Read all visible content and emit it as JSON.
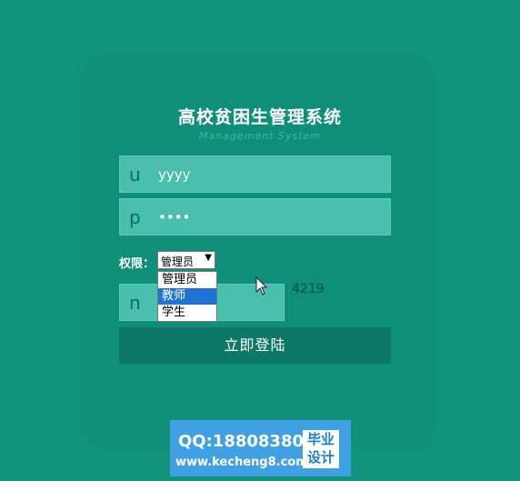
{
  "header": {
    "title": "高校贫困生管理系统",
    "subtitle": "Management System"
  },
  "form": {
    "username": {
      "icon_letter": "u",
      "value": "yyyy"
    },
    "password": {
      "icon_letter": "p",
      "value": "••••"
    },
    "role": {
      "label": "权限：",
      "selected": "管理员",
      "options": [
        "管理员",
        "教师",
        "学生"
      ],
      "highlighted": "教师"
    },
    "captcha": {
      "icon_letter": "n",
      "code": "4219"
    },
    "login_button": "立即登陆"
  },
  "watermark": {
    "qq": "QQ:188083800",
    "url": "www.kecheng8.com",
    "badge_line1": "毕业",
    "badge_line2": "设计"
  },
  "colors": {
    "background": "#10957c",
    "field": "#4abfad",
    "button": "#0c7865",
    "highlight": "#1e74d6"
  },
  "icons": {
    "cursor": "mouse-pointer-icon",
    "dropdown_arrow": "triangle-down-icon"
  }
}
